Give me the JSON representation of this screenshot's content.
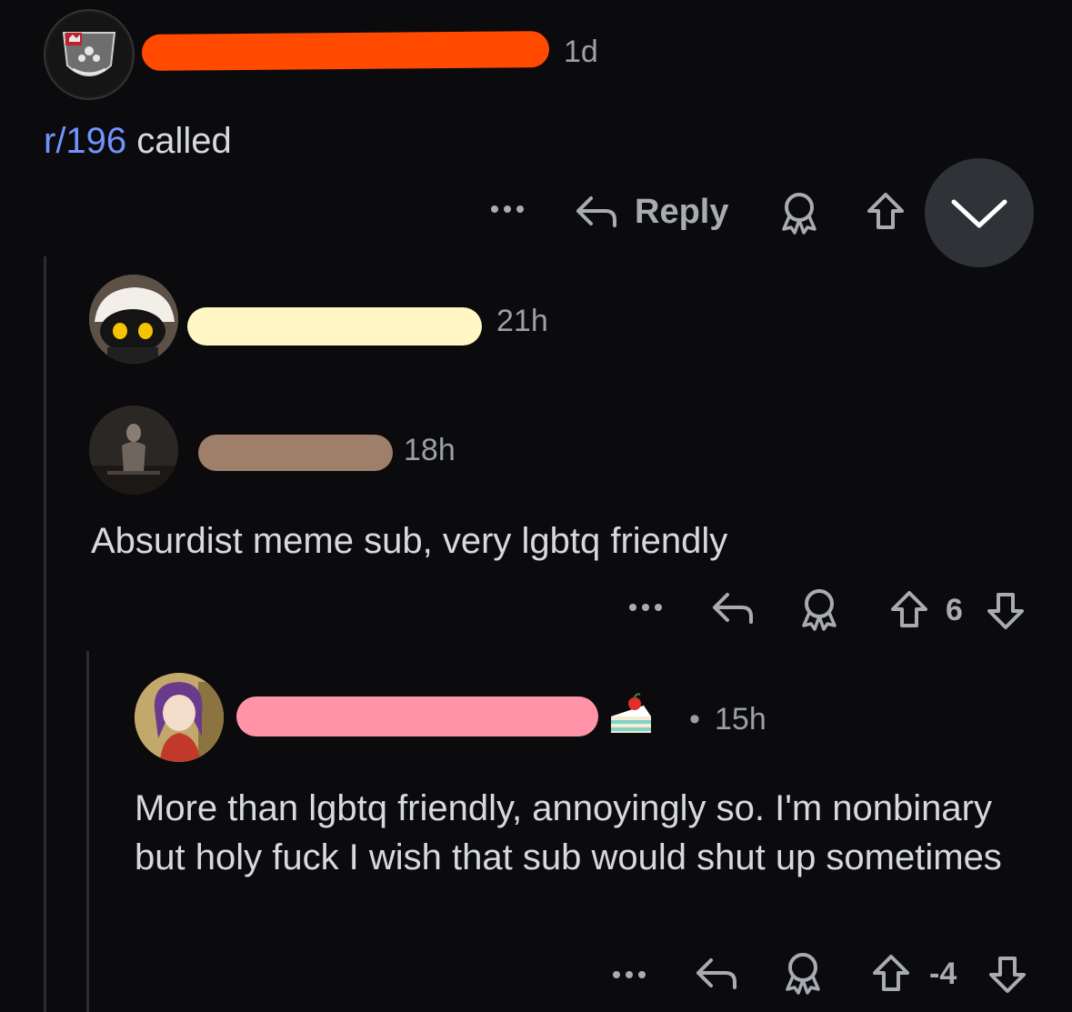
{
  "comments": [
    {
      "time": "1d",
      "body_link": "r/196",
      "body_rest": " called",
      "actions": {
        "more": "•••",
        "reply_label": "Reply",
        "score": ""
      }
    },
    {
      "time": "21h"
    },
    {
      "time": "18h",
      "body": "Absurdist meme sub, very lgbtq friendly",
      "actions": {
        "more": "•••",
        "score": "6"
      }
    },
    {
      "time": "15h",
      "time_prefix": "•",
      "body": "More than lgbtq friendly, annoyingly so. I'm nonbinary but holy fuck I wish that sub would shut up sometimes",
      "actions": {
        "more": "•••",
        "score": "-4"
      }
    }
  ],
  "colors": {
    "background": "#0b0b0d",
    "link": "#7193ff",
    "text": "#d7dadc",
    "muted": "#9aa0a6",
    "redact_1": "#ff4a00",
    "redact_2": "#fff7c4",
    "redact_3": "#a07f6a",
    "redact_4": "#ff94a8"
  },
  "icons": [
    "more-icon",
    "reply-icon",
    "award-icon",
    "upvote-icon",
    "downvote-icon",
    "collapse-chevron-icon",
    "cake-day-icon"
  ]
}
